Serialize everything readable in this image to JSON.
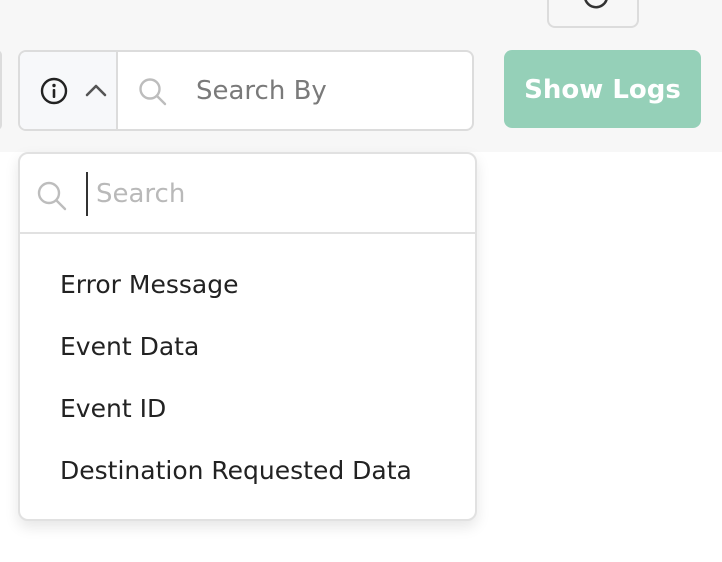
{
  "toolbar": {
    "refresh_icon": "refresh-icon",
    "search_by": {
      "info_icon": "info-icon",
      "chevron_icon": "chevron-up-icon",
      "search_icon": "search-icon",
      "placeholder": "Search By",
      "value": ""
    },
    "show_logs_label": "Show Logs"
  },
  "dropdown": {
    "search_placeholder": "Search",
    "search_value": "",
    "options": [
      {
        "label": "Error Message"
      },
      {
        "label": "Event Data"
      },
      {
        "label": "Event ID"
      },
      {
        "label": "Destination Requested Data"
      }
    ]
  },
  "colors": {
    "accent": "#95d0b8",
    "border": "#dcdcdc",
    "toolbar_bg": "#f7f7f7"
  }
}
